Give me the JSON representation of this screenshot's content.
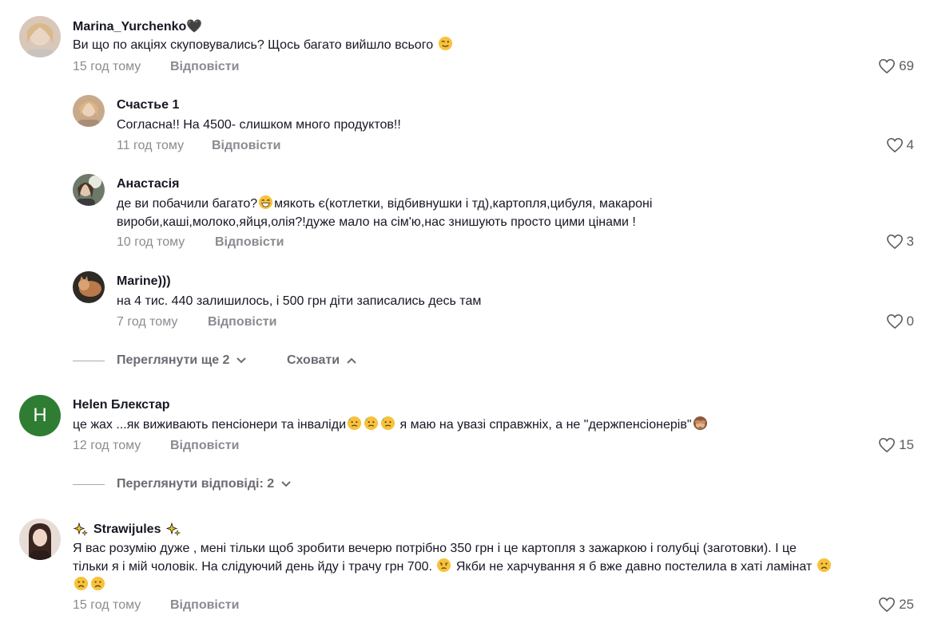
{
  "comments": [
    {
      "username": "Marina_Yurchenko🖤",
      "text_parts": [
        "Ви що по акціях скуповувались? Щось багато вийшло всього "
      ],
      "time": "15 год тому",
      "reply_label": "Відповісти",
      "likes": "69",
      "avatar_color": "#d9c7b8"
    },
    {
      "username": "Счастье 1",
      "text_parts": [
        "Согласна!! На 4500- слишком много продуктов!!"
      ],
      "time": "11 год тому",
      "reply_label": "Відповісти",
      "likes": "4",
      "avatar_color": "#c8a98a"
    },
    {
      "username": "Анастасія",
      "text_parts": [
        "де ви побачили багато?",
        "мякоть є(котлетки, відбивнушки і тд),картопля,цибуля, макароні",
        "вироби,каші,молоко,яйця,олія?!дуже мало на сім'ю,нас знишують просто цими цінами !"
      ],
      "time": "10 год тому",
      "reply_label": "Відповісти",
      "likes": "3",
      "avatar_color": "#6d7a6a"
    },
    {
      "username": "Marine)))",
      "text_parts": [
        "на 4 тис. 440 залишилось, і 500 грн діти записались десь там"
      ],
      "time": "7 год тому",
      "reply_label": "Відповісти",
      "likes": "0",
      "avatar_color": "#5a4636"
    },
    {
      "username": "Helen Блекстар",
      "avatar_letter": "H",
      "text_parts": [
        "це жах ...як виживають пенсіонери та інваліди",
        " я маю на увазі справжніх, а не \"держпенсіонерів\""
      ],
      "time": "12 год тому",
      "reply_label": "Відповісти",
      "likes": "15",
      "avatar_color": "#2e7d32"
    },
    {
      "username": "Strawijules",
      "text_parts": [
        "Я вас розумію дуже , мені тільки щоб зробити вечерю потрібно 350 грн і це картопля з зажаркою і голубці (заготовки). І це",
        "тільки я і мій чоловік. На слідуючий день йду і трачу грн 700. ",
        " Якби не харчування я б вже давно постелила в хаті ламінат "
      ],
      "time": "15 год тому",
      "reply_label": "Відповісти",
      "likes": "25",
      "avatar_color": "#e8ddd6"
    }
  ],
  "thread_controls": {
    "view_more": "Переглянути ще 2",
    "hide": "Сховати",
    "view_replies": "Переглянути відповіді: 2"
  },
  "colors": {
    "muted": "#8a8b91",
    "text": "#161823",
    "emoji_yellow": "#f7c23a"
  }
}
